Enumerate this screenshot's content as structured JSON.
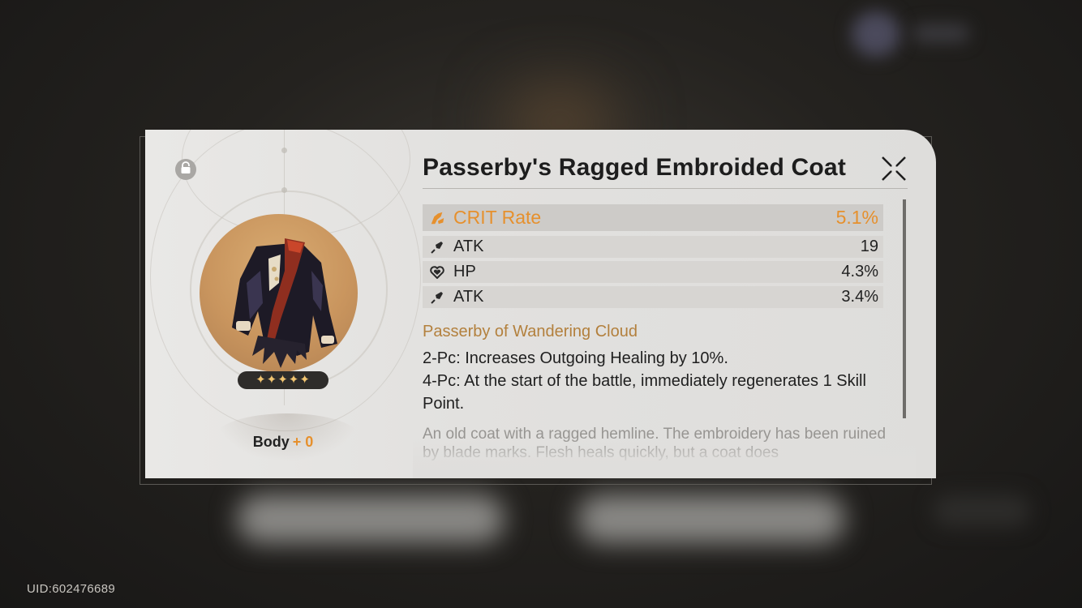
{
  "uid_label": "UID:602476689",
  "relic": {
    "title": "Passerby's Ragged Embroided Coat",
    "slot_label": "Body",
    "level": "+ 0",
    "stars": "✦✦✦✦✦",
    "rarity": 5,
    "main_stat": {
      "name": "CRIT Rate",
      "value": "5.1%",
      "icon": "crit-rate-icon"
    },
    "sub_stats": [
      {
        "name": "ATK",
        "value": "19",
        "icon": "atk-icon"
      },
      {
        "name": "HP",
        "value": "4.3%",
        "icon": "hp-icon"
      },
      {
        "name": "ATK",
        "value": "3.4%",
        "icon": "atk-icon"
      }
    ],
    "set_name": "Passerby of Wandering Cloud",
    "set_effects": [
      "2-Pc: Increases Outgoing Healing by 10%.",
      "4-Pc: At the start of the battle, immediately regenerates 1 Skill Point."
    ],
    "flavor_text": "An old coat with a ragged hemline. The embroidery has been ruined by blade marks. Flesh heals quickly, but a coat does"
  },
  "colors": {
    "accent_orange": "#e6902d",
    "set_name_gold": "#b3803d",
    "card_bg": "#e2e1df",
    "page_bg": "#1f1d1b"
  }
}
